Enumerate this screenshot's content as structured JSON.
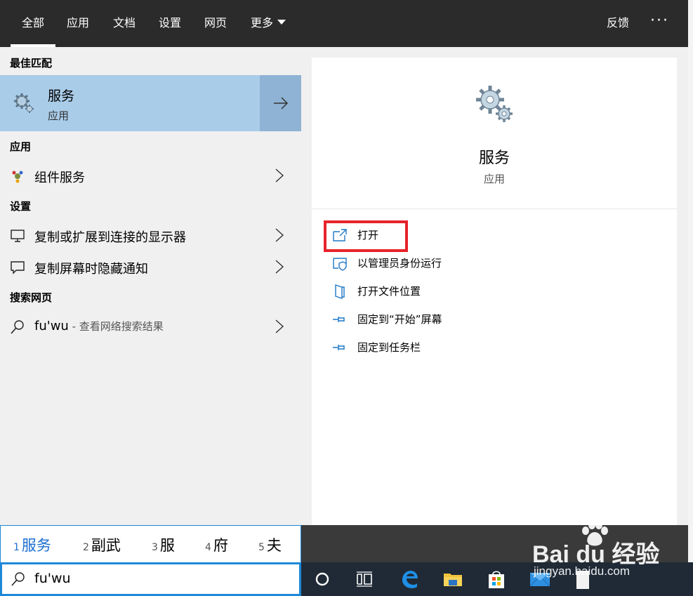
{
  "tabs": [
    {
      "label": "全部",
      "active": true
    },
    {
      "label": "应用"
    },
    {
      "label": "文档"
    },
    {
      "label": "设置"
    },
    {
      "label": "网页"
    },
    {
      "label": "更多"
    }
  ],
  "header": {
    "feedback": "反馈",
    "more_options": "···"
  },
  "left": {
    "best_match_label": "最佳匹配",
    "best_match": {
      "title": "服务",
      "subtitle": "应用",
      "icon": "gears-icon"
    },
    "apps_label": "应用",
    "apps": [
      {
        "label": "组件服务",
        "icon": "component-services-icon"
      }
    ],
    "settings_label": "设置",
    "settings": [
      {
        "label": "复制或扩展到连接的显示器",
        "icon": "monitor-icon"
      },
      {
        "label": "复制屏幕时隐藏通知",
        "icon": "speech-bubble-icon"
      }
    ],
    "web_label": "搜索网页",
    "web": {
      "query": "fu'wu",
      "suffix": " - 查看网络搜索结果",
      "icon": "search-icon"
    }
  },
  "preview": {
    "title": "服务",
    "subtitle": "应用",
    "actions": [
      {
        "label": "打开",
        "icon": "open-icon"
      },
      {
        "label": "以管理员身份运行",
        "icon": "shield-icon"
      },
      {
        "label": "打开文件位置",
        "icon": "file-location-icon"
      },
      {
        "label": "固定到“开始”屏幕",
        "icon": "pin-icon"
      },
      {
        "label": "固定到任务栏",
        "icon": "pin-icon"
      }
    ]
  },
  "ime": {
    "candidates": [
      {
        "num": "1",
        "text": "服务"
      },
      {
        "num": "2",
        "text": "副武"
      },
      {
        "num": "3",
        "text": "服"
      },
      {
        "num": "4",
        "text": "府"
      },
      {
        "num": "5",
        "text": "夫"
      }
    ]
  },
  "search": {
    "value": "fu'wu"
  },
  "taskbar": [
    "cortana-icon",
    "task-view-icon",
    "edge-icon",
    "file-explorer-icon",
    "store-icon",
    "mail-icon",
    "document-icon"
  ],
  "watermark": {
    "brand": "Bai du 经验",
    "url": "jingyan.baidu.com"
  },
  "colors": {
    "accent": "#1e88d8",
    "highlight_row": "#a9cce9",
    "highlight_box": "#e8232a",
    "topbar": "#2b2b2b"
  }
}
